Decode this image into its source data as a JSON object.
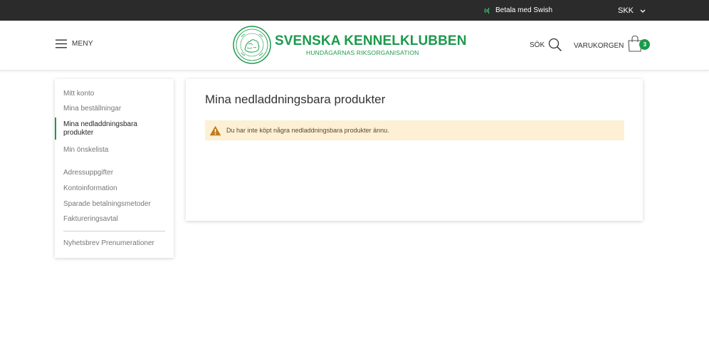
{
  "topbar": {
    "swish_label": "Betala med Swish",
    "currency": "SKK"
  },
  "header": {
    "menu_label": "MENY",
    "logo_title": "SVENSKA KENNELKLUBBEN",
    "logo_subtitle": "HUNDÄGARNAS RIKSORGANISATION",
    "search_label": "SÖK",
    "cart_label": "VARUKORGEN",
    "cart_count": "3"
  },
  "sidebar": {
    "items": [
      {
        "label": "Mitt konto"
      },
      {
        "label": "Mina beställningar"
      },
      {
        "label": "Mina nedladdningsbara produkter"
      },
      {
        "label": "Min önskelista"
      },
      {
        "label": "Adressuppgifter"
      },
      {
        "label": "Kontoinformation"
      },
      {
        "label": "Sparade betalningsmetoder"
      },
      {
        "label": "Faktureringsavtal"
      },
      {
        "label": "Nyhetsbrev Prenumerationer"
      }
    ],
    "active_index": 2
  },
  "main": {
    "title": "Mina nedladdningsbara produkter",
    "notice": "Du har inte köpt några nedladdningsbara produkter ännu."
  },
  "colors": {
    "brand_green": "#1b9a4b",
    "topbar_bg": "#2b2b2b",
    "notice_bg": "#fdf0d5",
    "warning_icon": "#c07a1a"
  },
  "icons": {
    "swish": "swish-icon",
    "chevron": "chevron-down-icon",
    "menu": "hamburger-icon",
    "search": "search-icon",
    "cart": "shopping-bag-icon",
    "warning": "warning-icon"
  }
}
